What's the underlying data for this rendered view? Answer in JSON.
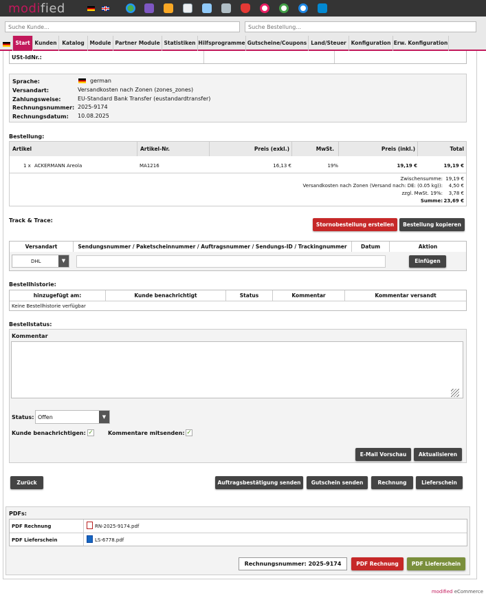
{
  "brand": {
    "logo_a": "modi",
    "logo_b": "fied"
  },
  "search": {
    "customer_placeholder": "Suche Kunde...",
    "order_placeholder": "Suche Bestellung..."
  },
  "nav": {
    "tabs": [
      "Start",
      "Kunden",
      "Katalog",
      "Module",
      "Partner Module",
      "Statistiken",
      "Hilfsprogramme",
      "Gutscheine/Coupons",
      "Land/Steuer",
      "Konfiguration",
      "Erw. Konfiguration"
    ],
    "active": "Start"
  },
  "vat": {
    "label": "USt-IdNr.:"
  },
  "info": {
    "rows": [
      {
        "label": "Sprache:",
        "value": "german"
      },
      {
        "label": "Versandart:",
        "value": "Versandkosten nach Zonen (zones_zones)"
      },
      {
        "label": "Zahlungsweise:",
        "value": "EU-Standard Bank Transfer (eustandardtransfer)"
      },
      {
        "label": "Rechnungsnummer:",
        "value": "2025-9174"
      },
      {
        "label": "Rechnungsdatum:",
        "value": "10.08.2025"
      }
    ]
  },
  "order": {
    "title": "Bestellung:",
    "headers": [
      "Artikel",
      "Artikel-Nr.",
      "Preis (exkl.)",
      "MwSt.",
      "Preis (inkl.)",
      "Total"
    ],
    "item": {
      "qty": "1 x",
      "name": "ACKERMANN Areola",
      "sku": "MA1216",
      "net": "16,13 €",
      "tax": "19%",
      "gross": "19,19 €",
      "total": "19,19 €"
    },
    "totals": [
      {
        "label": "Zwischensumme:",
        "value": "19,19 €"
      },
      {
        "label": "Versandkosten nach Zonen (Versand nach: DE: (0.05 kg)):",
        "value": "4,50 €"
      },
      {
        "label": "zzgl. MwSt. 19%:",
        "value": "3,78 €"
      },
      {
        "label": "Summe:",
        "value": "23,69 €"
      }
    ]
  },
  "track": {
    "title": "Track & Trace:",
    "cancel_btn": "Stornobestellung erstellen",
    "copy_btn": "Bestellung kopieren",
    "headers": [
      "Versandart",
      "Sendungsnummer / Paketscheinnummer / Auftragsnummer / Sendungs-ID / Trackingnummer",
      "Datum",
      "Aktion"
    ],
    "carrier": "DHL",
    "insert_btn": "Einfügen"
  },
  "history": {
    "title": "Bestellhistorie:",
    "headers": [
      "hinzugefügt am:",
      "Kunde benachrichtigt",
      "Status",
      "Kommentar",
      "Kommentar versandt"
    ],
    "empty": "Keine Bestellhistorie verfügbar"
  },
  "status": {
    "title": "Bestellstatus:",
    "comment_label": "Kommentar",
    "status_label": "Status:",
    "status_value": "Offen",
    "notify_label": "Kunde benachrichtigen:",
    "send_comments_label": "Kommentare mitsenden:",
    "preview_btn": "E-Mail Vorschau",
    "update_btn": "Aktualisieren"
  },
  "actions": {
    "back": "Zurück",
    "confirm": "Auftragsbestätigung senden",
    "voucher": "Gutschein senden",
    "invoice": "Rechnung",
    "delivery": "Lieferschein"
  },
  "pdfs": {
    "title": "PDFs:",
    "rows": [
      {
        "label": "PDF Rechnung",
        "file": "RN-2025-9174.pdf"
      },
      {
        "label": "PDF Lieferschein",
        "file": "LS-6778.pdf"
      }
    ],
    "invoice_number": "Rechnungsnummer: 2025-9174",
    "pdf_invoice_btn": "PDF Rechnung",
    "pdf_delivery_btn": "PDF Lieferschein"
  },
  "footer": {
    "brand": "modified",
    "suffix": " eCommerce"
  },
  "colors": {
    "brand": "#c2185b",
    "topbar": "#343434",
    "danger": "#c62828",
    "olive": "#7a8f3c",
    "dark_button": "#444444"
  }
}
